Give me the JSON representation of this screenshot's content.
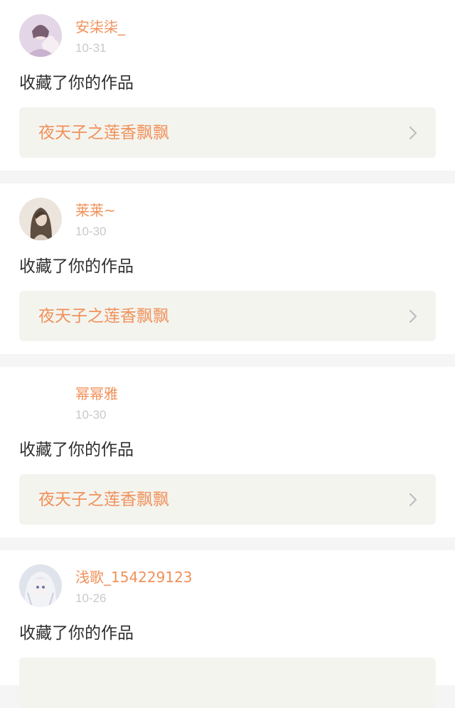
{
  "notifications": [
    {
      "username": "安柒柒_",
      "date": "10-31",
      "action": "收藏了你的作品",
      "work_title": "夜天子之莲香飘飘",
      "avatar_icon": "avatar-girl-with-plush",
      "avatar_colors": [
        "#d8c8dc",
        "#a58db2"
      ]
    },
    {
      "username": "莱莱~",
      "date": "10-30",
      "action": "收藏了你的作品",
      "work_title": "夜天子之莲香飘飘",
      "avatar_icon": "avatar-long-hair-portrait",
      "avatar_colors": [
        "#e8dfd6",
        "#6b5a4c"
      ]
    },
    {
      "username": "幂幂雅",
      "date": "10-30",
      "action": "收藏了你的作品",
      "work_title": "夜天子之莲香飘飘",
      "avatar_icon": "avatar-blank",
      "avatar_colors": [
        "#ffffff",
        "#ffffff"
      ]
    },
    {
      "username": "浅歌_154229123",
      "date": "10-26",
      "action": "收藏了你的作品",
      "work_title": "",
      "avatar_icon": "avatar-anime-white-hair",
      "avatar_colors": [
        "#e6e8ef",
        "#9aa3b8"
      ]
    }
  ],
  "colors": {
    "accent": "#f0915a",
    "date": "#c9c9c9",
    "card_bg": "#f4f4ef",
    "separator": "#f5f5f5",
    "chevron": "#bdbdbd"
  }
}
